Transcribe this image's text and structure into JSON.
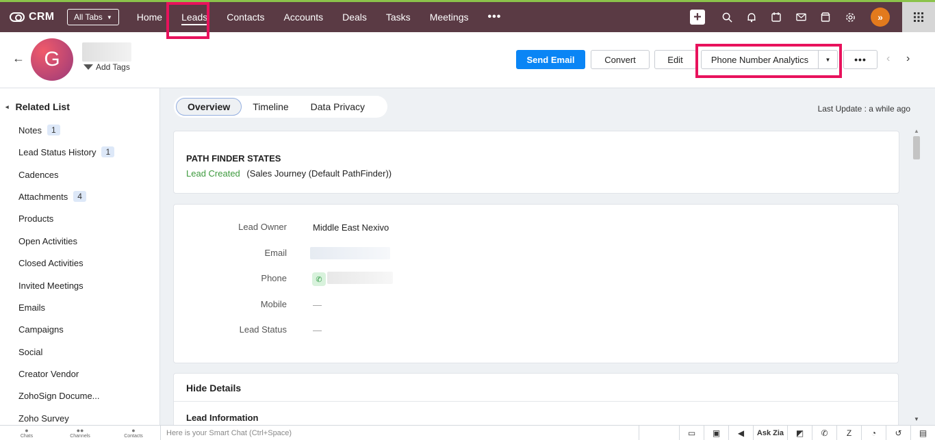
{
  "topnav": {
    "app_name": "CRM",
    "all_tabs_label": "All Tabs",
    "tabs": [
      "Home",
      "Leads",
      "Contacts",
      "Accounts",
      "Deals",
      "Tasks",
      "Meetings"
    ],
    "active_tab": "Leads",
    "more_label": "•••"
  },
  "record": {
    "avatar_letter": "G",
    "add_tags_label": "Add Tags",
    "send_email_label": "Send Email",
    "convert_label": "Convert",
    "edit_label": "Edit",
    "phone_analytics_label": "Phone Number Analytics",
    "more_label": "•••"
  },
  "sidebar": {
    "title": "Related List",
    "items": [
      {
        "label": "Notes",
        "count": "1"
      },
      {
        "label": "Lead Status History",
        "count": "1"
      },
      {
        "label": "Cadences",
        "count": ""
      },
      {
        "label": "Attachments",
        "count": "4"
      },
      {
        "label": "Products",
        "count": ""
      },
      {
        "label": "Open Activities",
        "count": ""
      },
      {
        "label": "Closed Activities",
        "count": ""
      },
      {
        "label": "Invited Meetings",
        "count": ""
      },
      {
        "label": "Emails",
        "count": ""
      },
      {
        "label": "Campaigns",
        "count": ""
      },
      {
        "label": "Social",
        "count": ""
      },
      {
        "label": "Creator Vendor",
        "count": ""
      },
      {
        "label": "ZohoSign Docume...",
        "count": ""
      },
      {
        "label": "Zoho Survey",
        "count": ""
      }
    ]
  },
  "main": {
    "subtabs": [
      "Overview",
      "Timeline",
      "Data Privacy"
    ],
    "last_update": "Last Update : a while ago",
    "pathfinder_title": "PATH FINDER STATES",
    "pathfinder_state": "Lead Created",
    "pathfinder_journey": "(Sales Journey (Default PathFinder))",
    "fields": {
      "lead_owner_label": "Lead Owner",
      "lead_owner_value": "Middle East Nexivo",
      "email_label": "Email",
      "phone_label": "Phone",
      "mobile_label": "Mobile",
      "mobile_value": "—",
      "lead_status_label": "Lead Status",
      "lead_status_value": "—"
    },
    "hide_details_label": "Hide Details",
    "lead_information_label": "Lead Information"
  },
  "bottombar": {
    "chats_label": "Chats",
    "channels_label": "Channels",
    "contacts_label": "Contacts",
    "smart_chat_placeholder": "Here is your Smart Chat (Ctrl+Space)",
    "ask_zia_label": "Ask Zia"
  }
}
